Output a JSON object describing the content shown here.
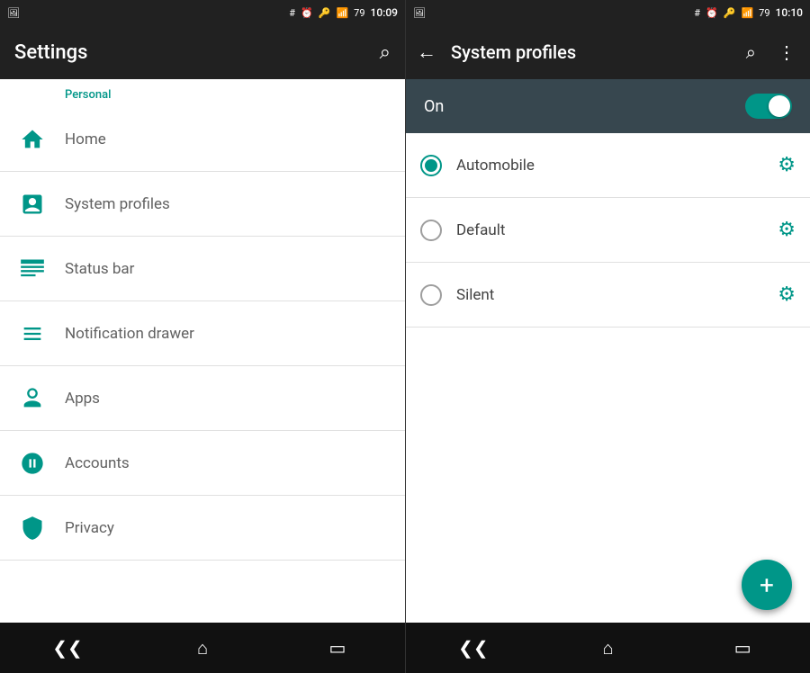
{
  "left": {
    "status_bar": {
      "time": "10:09"
    },
    "app_bar": {
      "title": "Settings",
      "search_label": "search"
    },
    "section_label": "Personal",
    "menu_items": [
      {
        "id": "home",
        "label": "Home",
        "icon": "home"
      },
      {
        "id": "system_profiles",
        "label": "System profiles",
        "icon": "profiles"
      },
      {
        "id": "status_bar",
        "label": "Status bar",
        "icon": "status_bar"
      },
      {
        "id": "notification_drawer",
        "label": "Notification drawer",
        "icon": "notification"
      },
      {
        "id": "apps",
        "label": "Apps",
        "icon": "apps"
      },
      {
        "id": "accounts",
        "label": "Accounts",
        "icon": "accounts"
      },
      {
        "id": "privacy",
        "label": "Privacy",
        "icon": "privacy"
      }
    ],
    "nav": {
      "back": "‹‹",
      "home": "⌂",
      "recents": "▭"
    }
  },
  "right": {
    "status_bar": {
      "time": "10:10"
    },
    "app_bar": {
      "title": "System profiles",
      "back_label": "back",
      "search_label": "search",
      "more_label": "more options"
    },
    "toggle": {
      "label": "On",
      "state": true
    },
    "profiles": [
      {
        "id": "automobile",
        "label": "Automobile",
        "selected": true
      },
      {
        "id": "default",
        "label": "Default",
        "selected": false
      },
      {
        "id": "silent",
        "label": "Silent",
        "selected": false
      }
    ],
    "fab_label": "+",
    "nav": {
      "back": "‹‹",
      "home": "⌂",
      "recents": "▭"
    }
  }
}
